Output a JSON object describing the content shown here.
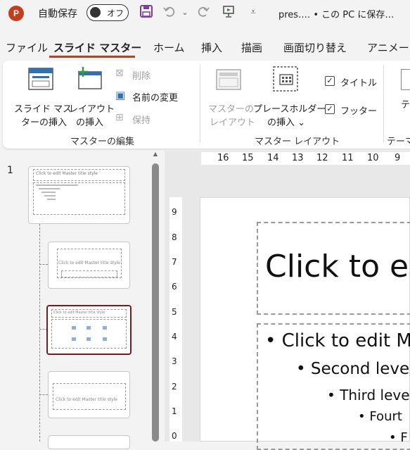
{
  "titlebar": {
    "logo_letter": "P",
    "autosave_label": "自動保存",
    "autosave_state": "オフ",
    "doc_title": "pres.… • この PC に保存…"
  },
  "tabs": [
    "ファイル",
    "スライド マスター",
    "ホーム",
    "挿入",
    "描画",
    "画面切り替え",
    "アニメーシ"
  ],
  "ribbon": {
    "insert_master_l1": "スライド マス",
    "insert_master_l2": "ターの挿入",
    "insert_layout_l1": "レイアウト",
    "insert_layout_l2": "の挿入",
    "delete": "削除",
    "rename": "名前の変更",
    "preserve": "保持",
    "group_edit_master": "マスターの編集",
    "master_layout_l1": "マスターの",
    "master_layout_l2": "レイアウト",
    "insert_placeholder_l1": "プレースホルダー",
    "insert_placeholder_l2": "の挿入 ⌄",
    "title_check": "タイトル",
    "footer_check": "フッター",
    "group_master_layout": "マスター レイアウト",
    "theme_partial": "テ",
    "theme_group_partial": "テーマ"
  },
  "thumbs": {
    "slide_number": "1",
    "master_title": "Click to edit Master title style",
    "layout_title": "Click to edit Master title style"
  },
  "ruler": {
    "h_ticks": [
      "16",
      "15",
      "14",
      "13",
      "12",
      "11",
      "10",
      "9"
    ],
    "v_ticks": [
      "9",
      "8",
      "7",
      "6",
      "5",
      "4",
      "3",
      "2",
      "1",
      "0"
    ]
  },
  "slide": {
    "title": "Click to ed",
    "bullets": [
      "Click to edit M",
      "Second leve",
      "Third leve",
      "Fourt",
      "F"
    ]
  },
  "colors": {
    "accent": "#c43e1c",
    "selected_border": "#7b1a1a"
  }
}
